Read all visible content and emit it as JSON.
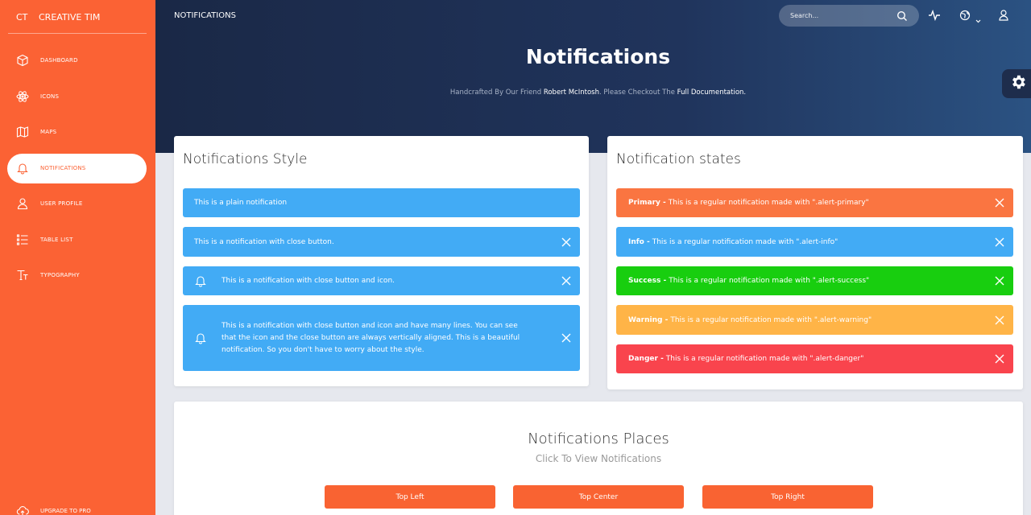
{
  "brand": {
    "mini": "CT",
    "name": "CREATIVE TIM"
  },
  "sidebar": {
    "items": [
      {
        "label": "DASHBOARD",
        "icon": "cube-icon"
      },
      {
        "label": "ICONS",
        "icon": "atom-icon"
      },
      {
        "label": "MAPS",
        "icon": "map-icon"
      },
      {
        "label": "NOTIFICATIONS",
        "icon": "bell-icon",
        "active": true
      },
      {
        "label": "USER PROFILE",
        "icon": "user-icon"
      },
      {
        "label": "TABLE LIST",
        "icon": "list-icon"
      },
      {
        "label": "TYPOGRAPHY",
        "icon": "text-icon"
      }
    ],
    "upgrade": "UPGRADE TO PRO"
  },
  "header": {
    "page_label": "NOTIFICATIONS",
    "search_placeholder": "Search...",
    "title": "Notifications",
    "subtitle_prefix": "Handcrafted By Our Friend ",
    "subtitle_author": "Robert McIntosh",
    "subtitle_middle": ". Please Checkout The ",
    "subtitle_link": "Full Documentation."
  },
  "styles_card": {
    "title": "Notifications Style",
    "alerts": [
      "This is a plain notification",
      "This is a notification with close button.",
      "This is a notification with close button and icon.",
      "This is a notification with close button and icon and have many lines. You can see that the icon and the close button are always vertically aligned. This is a beautiful notification. So you don't have to worry about the style."
    ]
  },
  "states_card": {
    "title": "Notification states",
    "alerts": [
      {
        "label": "Primary -",
        "text": "This is a regular notification made with \".alert-primary\""
      },
      {
        "label": "Info -",
        "text": "This is a regular notification made with \".alert-info\""
      },
      {
        "label": "Success -",
        "text": "This is a regular notification made with \".alert-success\""
      },
      {
        "label": "Warning -",
        "text": "This is a regular notification made with \".alert-warning\""
      },
      {
        "label": "Danger -",
        "text": "This is a regular notification made with \".alert-danger\""
      }
    ]
  },
  "places_card": {
    "title": "Notifications Places",
    "subtitle": "Click To View Notifications",
    "buttons": [
      "Top Left",
      "Top Center",
      "Top Right"
    ]
  },
  "colors": {
    "sidebar": "#fb6234",
    "primary": "#fa7541",
    "info": "#42abf5",
    "success": "#18ce0f",
    "warning": "#ffb447",
    "danger": "#f9444d"
  }
}
